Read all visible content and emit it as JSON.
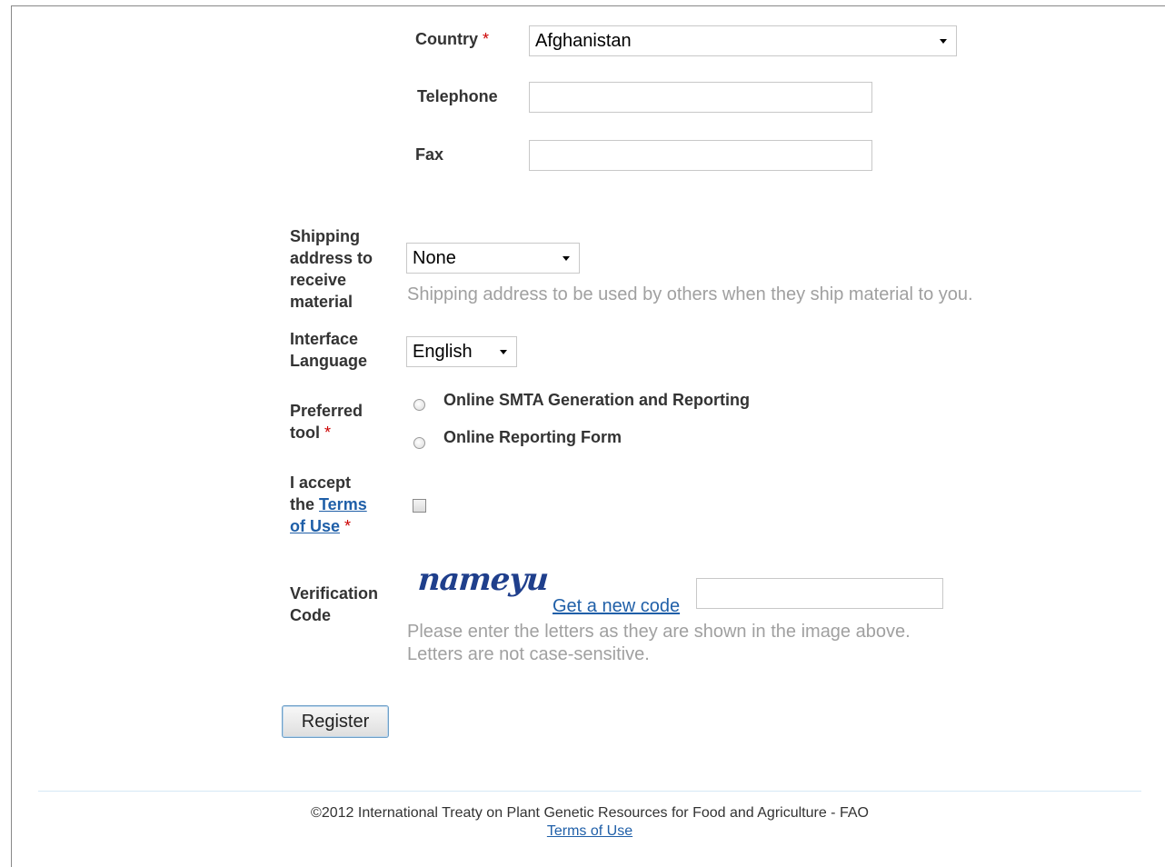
{
  "form": {
    "country": {
      "label": "Country",
      "required_mark": "*",
      "value": "Afghanistan"
    },
    "telephone": {
      "label": "Telephone",
      "value": ""
    },
    "fax": {
      "label": "Fax",
      "value": ""
    },
    "shipping": {
      "label_lines": [
        "Shipping",
        "address to",
        "receive",
        "material"
      ],
      "value": "None",
      "hint": "Shipping address to be used by others when they ship material to you."
    },
    "interface_language": {
      "label_lines": [
        "Interface",
        "Language"
      ],
      "value": "English"
    },
    "preferred_tool": {
      "label_lines": [
        "Preferred",
        "tool"
      ],
      "required_mark": "*",
      "options": [
        "Online SMTA Generation and Reporting",
        "Online Reporting Form"
      ]
    },
    "terms": {
      "label_line1": "I accept",
      "label_the": "the",
      "link_part1": "Terms",
      "link_part2": "of Use",
      "required_mark": "*"
    },
    "verification": {
      "label_lines": [
        "Verification",
        "Code"
      ],
      "captcha_text": "nameyu",
      "new_code_link": "Get a new code",
      "hint_lines": [
        "Please enter the letters as they are shown in the image above.",
        "Letters are not case-sensitive."
      ],
      "value": ""
    },
    "register_button": "Register"
  },
  "footer": {
    "copyright": "©2012 International Treaty on Plant Genetic Resources for Food and Agriculture - FAO",
    "terms_link": "Terms of Use"
  },
  "colors": {
    "required": "#cc0000",
    "link": "#1f5fa8",
    "hint": "#a0a0a0",
    "captcha": "#1f3f8c"
  }
}
